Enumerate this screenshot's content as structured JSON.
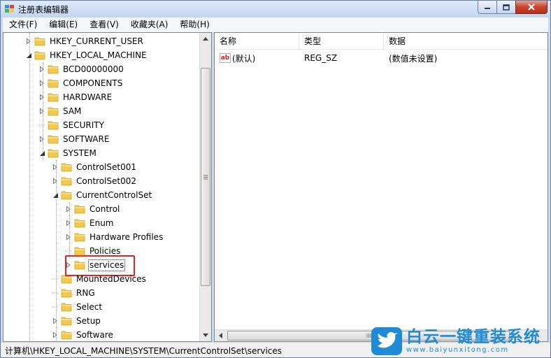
{
  "window": {
    "title": "注册表编辑器"
  },
  "menu": [
    "文件(F)",
    "编辑(E)",
    "查看(V)",
    "收藏夹(A)",
    "帮助(H)"
  ],
  "tree": [
    {
      "label": "HKEY_CURRENT_USER",
      "expander": "collapsed",
      "depth": 1
    },
    {
      "label": "HKEY_LOCAL_MACHINE",
      "expander": "expanded",
      "depth": 1
    },
    {
      "label": "BCD00000000",
      "expander": "collapsed",
      "depth": 2
    },
    {
      "label": "COMPONENTS",
      "expander": "collapsed",
      "depth": 2
    },
    {
      "label": "HARDWARE",
      "expander": "collapsed",
      "depth": 2
    },
    {
      "label": "SAM",
      "expander": "collapsed",
      "depth": 2
    },
    {
      "label": "SECURITY",
      "expander": "none",
      "depth": 2
    },
    {
      "label": "SOFTWARE",
      "expander": "collapsed",
      "depth": 2
    },
    {
      "label": "SYSTEM",
      "expander": "expanded",
      "depth": 2
    },
    {
      "label": "ControlSet001",
      "expander": "collapsed",
      "depth": 3
    },
    {
      "label": "ControlSet002",
      "expander": "collapsed",
      "depth": 3
    },
    {
      "label": "CurrentControlSet",
      "expander": "expanded",
      "depth": 3
    },
    {
      "label": "Control",
      "expander": "collapsed",
      "depth": 4
    },
    {
      "label": "Enum",
      "expander": "collapsed",
      "depth": 4
    },
    {
      "label": "Hardware Profiles",
      "expander": "collapsed",
      "depth": 4
    },
    {
      "label": "Policies",
      "expander": "none",
      "depth": 4
    },
    {
      "label": "services",
      "expander": "collapsed",
      "depth": 4,
      "selected": true
    },
    {
      "label": "MountedDevices",
      "expander": "none",
      "depth": 3
    },
    {
      "label": "RNG",
      "expander": "none",
      "depth": 3
    },
    {
      "label": "Select",
      "expander": "none",
      "depth": 3
    },
    {
      "label": "Setup",
      "expander": "collapsed",
      "depth": 3
    },
    {
      "label": "Software",
      "expander": "collapsed",
      "depth": 3
    }
  ],
  "list": {
    "columns": [
      "名称",
      "类型",
      "数据"
    ],
    "rows": [
      {
        "name": "(默认)",
        "type": "REG_SZ",
        "data": "(数值未设置)",
        "icon": "string-value-icon"
      }
    ]
  },
  "status": {
    "path": "计算机\\HKEY_LOCAL_MACHINE\\SYSTEM\\CurrentControlSet\\services"
  },
  "watermark": {
    "text": "白云一键重装系统",
    "url": "www.baiyunxitong.com"
  },
  "colors": {
    "folder": "#f2c94c",
    "highlight_box": "#e22626",
    "watermark": "#1f8bd8"
  }
}
